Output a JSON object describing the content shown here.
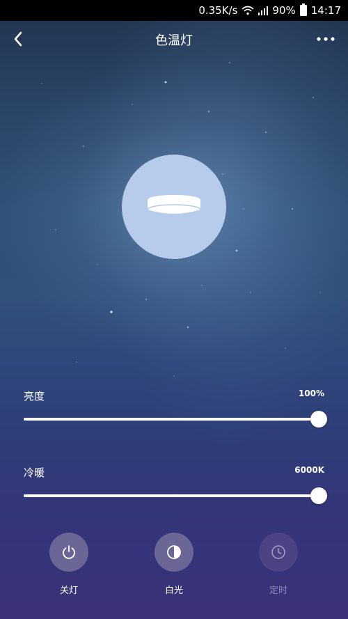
{
  "status_bar": {
    "speed": "0.35K/s",
    "battery": "90%",
    "time": "14:17"
  },
  "header": {
    "title": "色温灯"
  },
  "sliders": {
    "brightness": {
      "label": "亮度",
      "value": "100%",
      "level": 1.0
    },
    "color_temp": {
      "label": "冷暖",
      "value": "6000K",
      "level": 1.0
    }
  },
  "actions": {
    "power": {
      "label": "关灯",
      "icon": "power-icon"
    },
    "white": {
      "label": "白光",
      "icon": "half-circle-icon"
    },
    "timer": {
      "label": "定时",
      "icon": "clock-icon",
      "enabled": false
    }
  },
  "colors": {
    "lamp_circle": "#b7ccec",
    "accent": "#ffffff"
  }
}
